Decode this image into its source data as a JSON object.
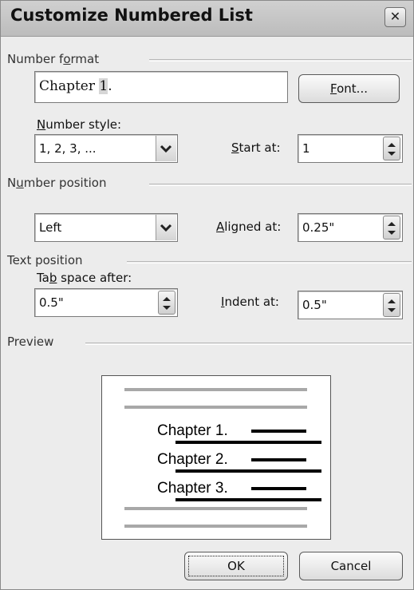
{
  "dialog": {
    "title": "Customize Numbered List",
    "close_glyph": "✕",
    "close_icon": "close-icon"
  },
  "number_format": {
    "group_label_pre": "Number f",
    "group_label_key": "o",
    "group_label_post": "rmat",
    "value_pre": "Chapter ",
    "value_hl": "1",
    "value_post": ".",
    "font_button_key": "F",
    "font_button_rest": "ont..."
  },
  "number_style": {
    "label_key": "N",
    "label_rest": "umber style:",
    "value": "1, 2, 3, ...",
    "dropdown_icon": "chevron-down-icon"
  },
  "start_at": {
    "label_key": "S",
    "label_rest": "tart at:",
    "value": "1",
    "spinner_icon": "spin-up-down-icon"
  },
  "number_position": {
    "group_label_pre": "N",
    "group_label_key": "u",
    "group_label_post": "mber position",
    "value": "Left",
    "dropdown_icon": "chevron-down-icon"
  },
  "aligned_at": {
    "label_key": "A",
    "label_rest": "ligned at:",
    "value": "0.25\"",
    "spinner_icon": "spin-up-down-icon"
  },
  "text_position": {
    "group_label": "Text position",
    "tab_label_pre": "Ta",
    "tab_label_key": "b",
    "tab_label_post": " space after:",
    "tab_value": "0.5\"",
    "indent_label_key": "I",
    "indent_label_rest": "ndent at:",
    "indent_value": "0.5\""
  },
  "preview": {
    "group_label": "Preview",
    "lines": [
      "Chapter 1.",
      "Chapter 2.",
      "Chapter 3."
    ]
  },
  "buttons": {
    "ok": "OK",
    "cancel": "Cancel"
  }
}
